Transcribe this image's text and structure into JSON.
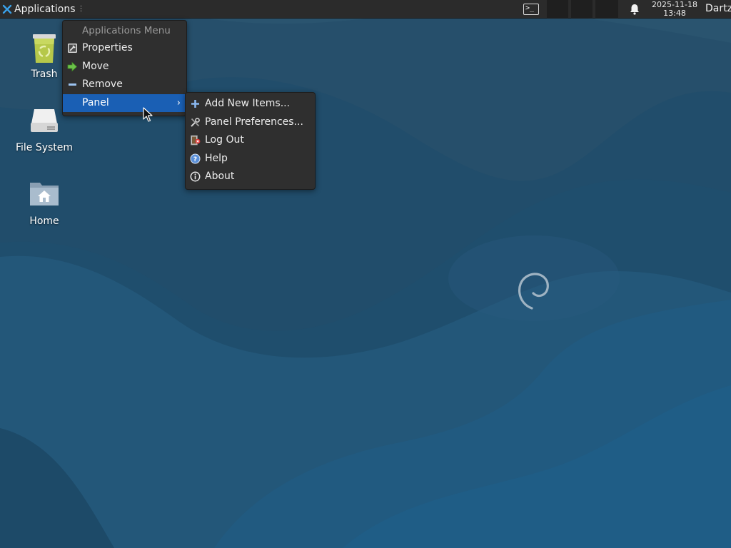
{
  "colors": {
    "panel_bg": "#2b2b2b",
    "menu_bg": "#2f2f2f",
    "highlight": "#1a5fb4",
    "wallpaper": "#1e4a68"
  },
  "top_panel": {
    "applications_label": "Applications",
    "applications_icon": "xfce-mouse-icon",
    "launcher_icon": "terminal-icon",
    "notification_icon": "bell-icon",
    "clock": {
      "date": "2025-11-18",
      "time": "13:48"
    },
    "user": "Dartz"
  },
  "desktop": {
    "icons": [
      {
        "label": "Trash",
        "icon": "trash-icon"
      },
      {
        "label": "File System",
        "icon": "drive-icon"
      },
      {
        "label": "Home",
        "icon": "home-folder-icon"
      }
    ]
  },
  "main_menu": {
    "header": "Applications Menu",
    "items": [
      {
        "label": "Properties",
        "icon": "properties-icon"
      },
      {
        "label": "Move",
        "icon": "move-arrow-icon"
      },
      {
        "label": "Remove",
        "icon": "remove-icon"
      },
      {
        "label": "Panel",
        "icon": "none",
        "submenu_arrow": "›",
        "active": true
      }
    ]
  },
  "panel_submenu": {
    "items": [
      {
        "label": "Add New Items...",
        "icon": "add-icon"
      },
      {
        "label": "Panel Preferences...",
        "icon": "preferences-tools-icon"
      },
      {
        "label": "Log Out",
        "icon": "logout-icon"
      },
      {
        "label": "Help",
        "icon": "help-icon"
      },
      {
        "label": "About",
        "icon": "info-icon"
      }
    ]
  }
}
